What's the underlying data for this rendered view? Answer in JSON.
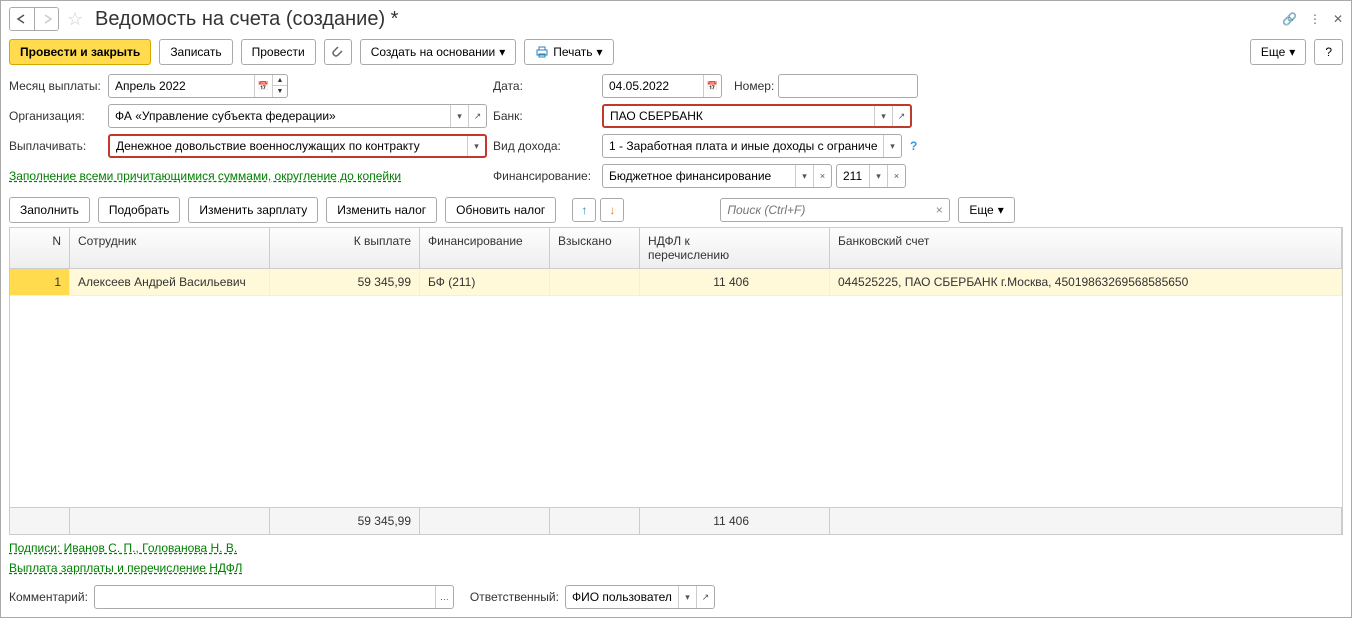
{
  "title": "Ведомость на счета (создание) *",
  "toolbar": {
    "post_close": "Провести и закрыть",
    "save": "Записать",
    "post": "Провести",
    "create_based": "Создать на основании",
    "print": "Печать",
    "more": "Еще",
    "help": "?"
  },
  "form": {
    "month_label": "Месяц выплаты:",
    "month_value": "Апрель 2022",
    "date_label": "Дата:",
    "date_value": "04.05.2022",
    "number_label": "Номер:",
    "number_value": "",
    "org_label": "Организация:",
    "org_value": "ФА «Управление субъекта федерации»",
    "bank_label": "Банк:",
    "bank_value": "ПАО СБЕРБАНК",
    "pay_label": "Выплачивать:",
    "pay_value": "Денежное довольствие военнослужащих по контракту",
    "income_label": "Вид дохода:",
    "income_value": "1 - Заработная плата и иные доходы с ограниче",
    "fill_link": "Заполнение всеми причитающимися суммами, округление до копейки",
    "finance_label": "Финансирование:",
    "finance_value": "Бюджетное финансирование",
    "finance_code": "211"
  },
  "table_toolbar": {
    "fill": "Заполнить",
    "pick": "Подобрать",
    "edit_salary": "Изменить зарплату",
    "edit_tax": "Изменить налог",
    "update_tax": "Обновить налог",
    "search_placeholder": "Поиск (Ctrl+F)",
    "more": "Еще"
  },
  "grid": {
    "headers": {
      "n": "N",
      "employee": "Сотрудник",
      "payable": "К выплате",
      "financing": "Финансирование",
      "collected": "Взыскано",
      "ndfl": "НДФЛ к перечислению",
      "bank": "Банковский счет"
    },
    "rows": [
      {
        "n": "1",
        "employee": "Алексеев Андрей Васильевич",
        "payable": "59 345,99",
        "financing": "БФ (211)",
        "collected": "",
        "ndfl": "11 406",
        "bank": "044525225, ПАО СБЕРБАНК г.Москва, 45019863269568585650"
      }
    ],
    "totals": {
      "payable": "59 345,99",
      "ndfl": "11 406"
    }
  },
  "links": {
    "signatures": "Подписи: Иванов С. П., Голованова Н. В.",
    "payout": "Выплата зарплаты и перечисление НДФЛ"
  },
  "bottom": {
    "comment_label": "Комментарий:",
    "comment_value": "",
    "responsible_label": "Ответственный:",
    "responsible_value": "ФИО пользователя"
  }
}
